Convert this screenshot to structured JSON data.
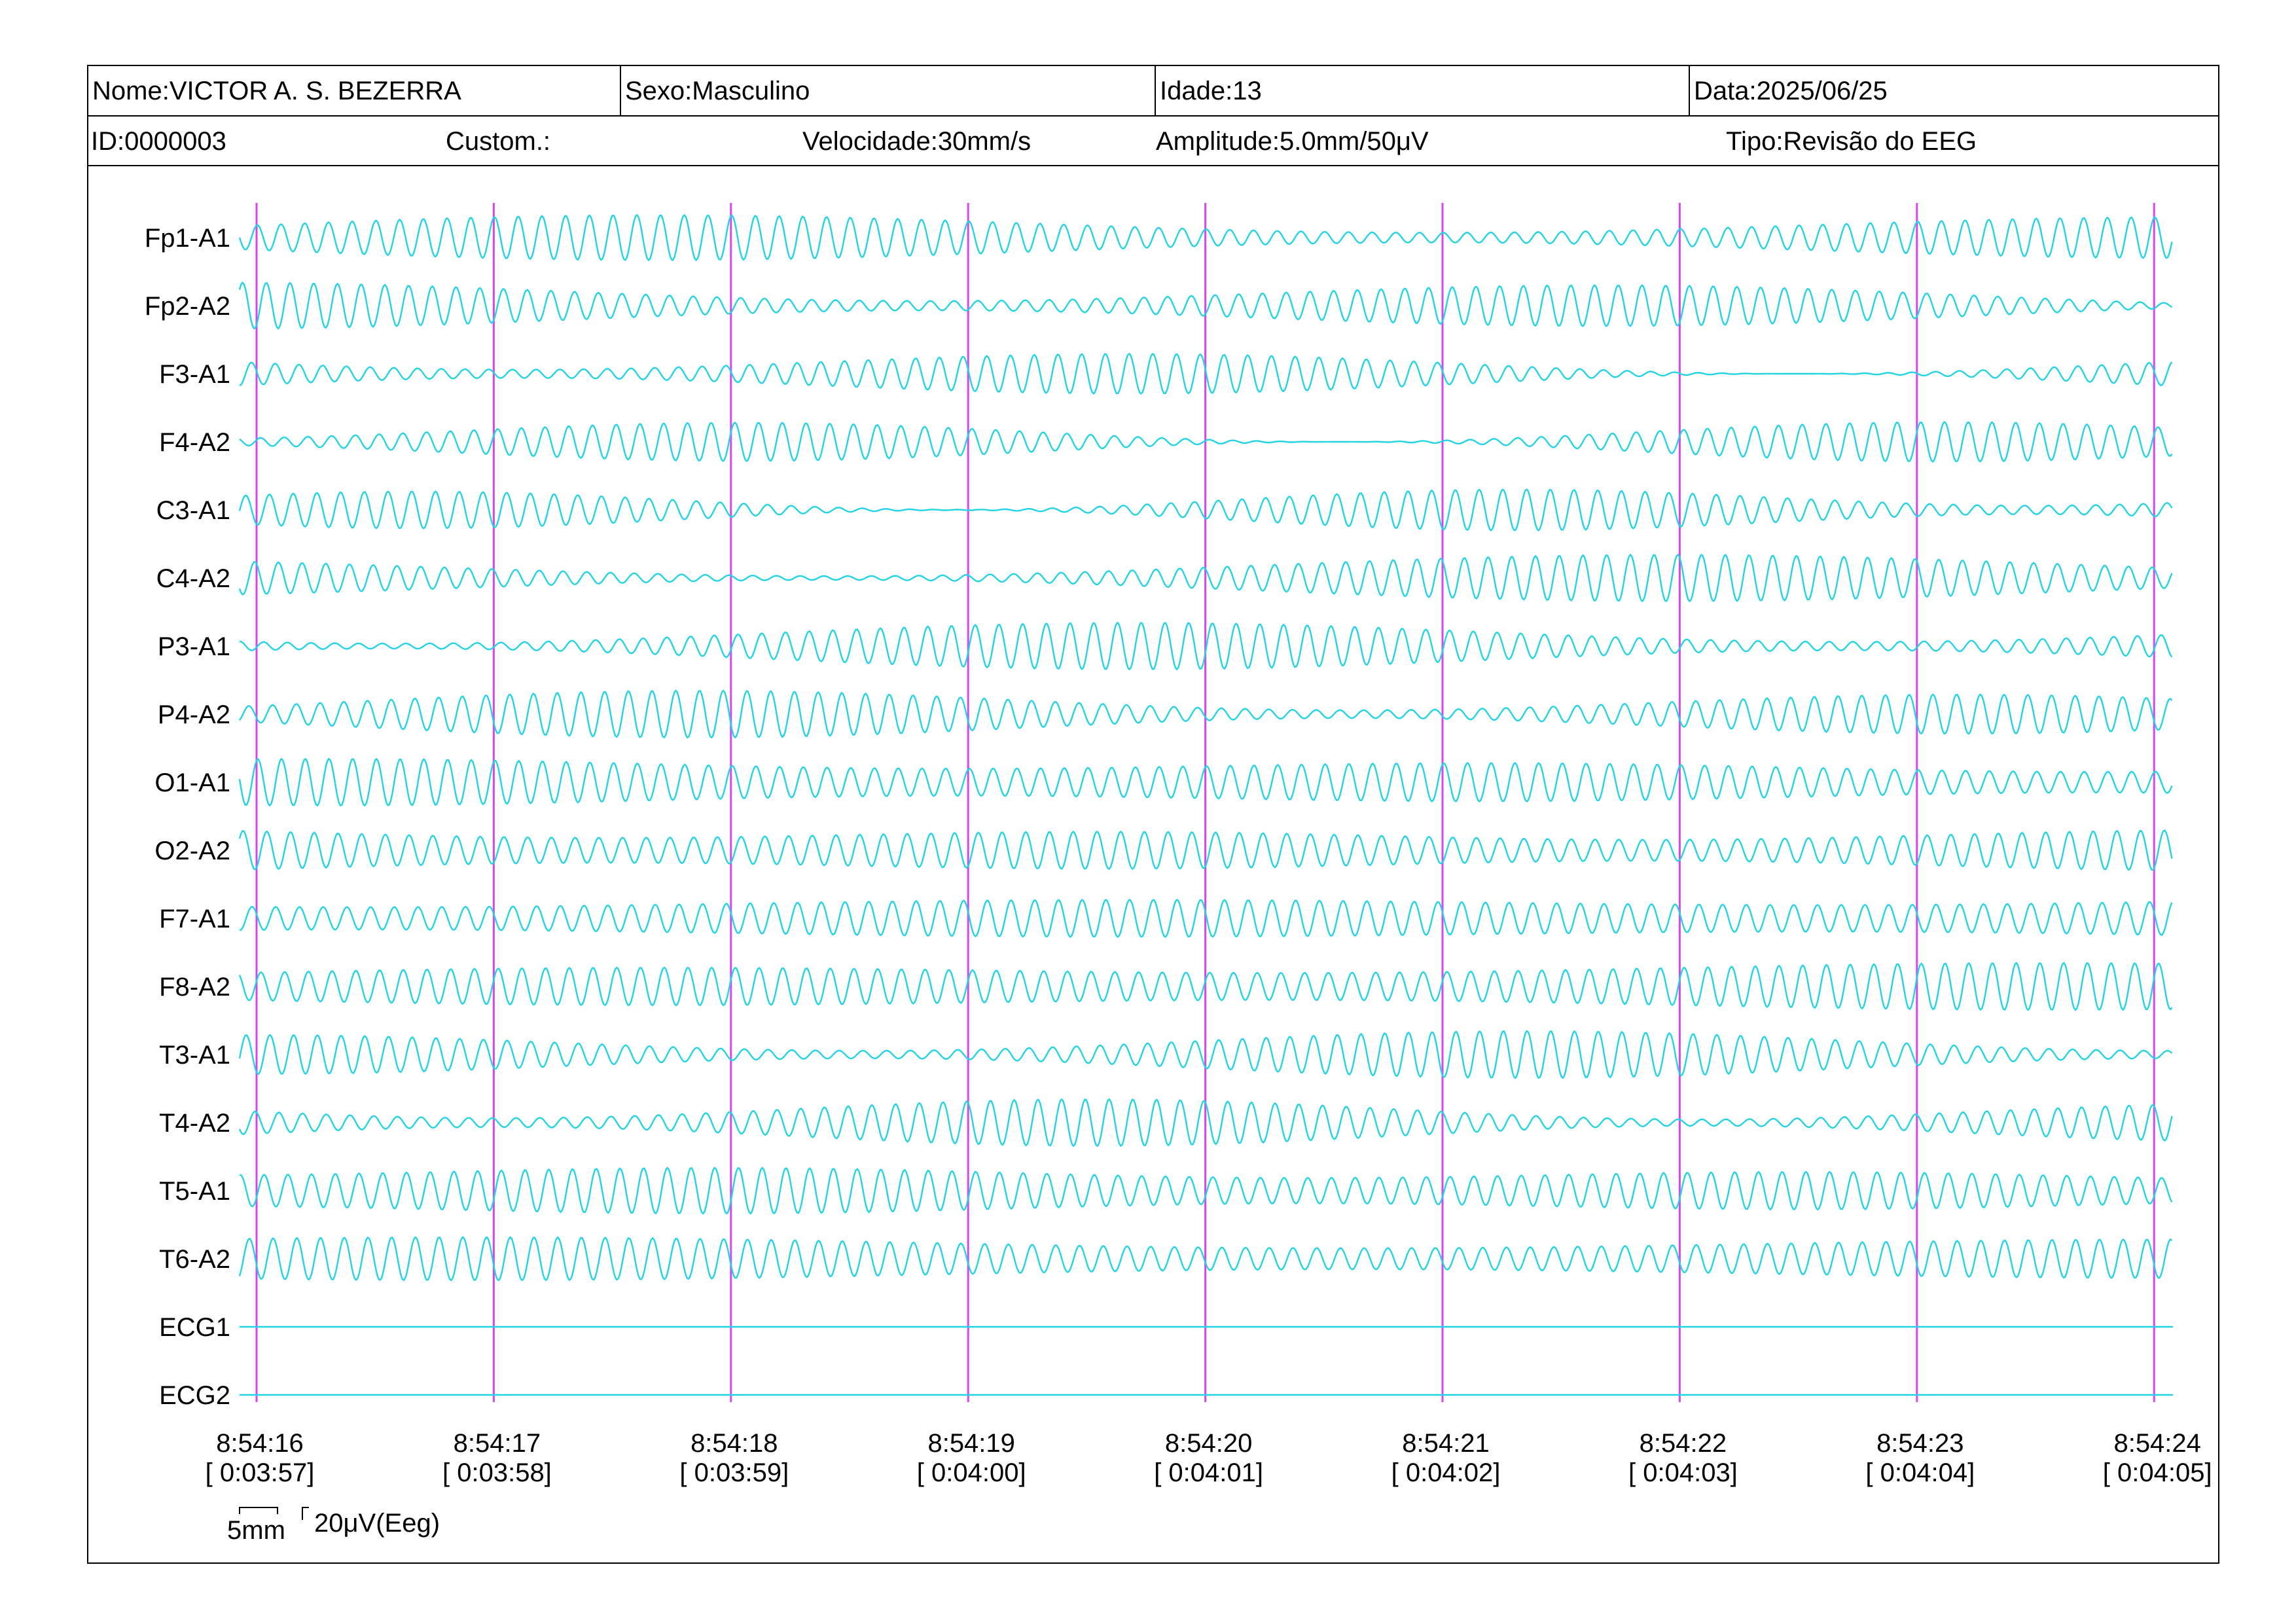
{
  "header": {
    "nome": "Nome:VICTOR A. S. BEZERRA",
    "sexo": "Sexo:Masculino",
    "idade": "Idade:13",
    "data": "Data:2025/06/25",
    "id": "ID:0000003",
    "custom": "Custom.:",
    "velocidade": "Velocidade:30mm/s",
    "amplitude": "Amplitude:5.0mm/50μV",
    "tipo": "Tipo:Revisão do EEG"
  },
  "colors": {
    "trace": "#22d3e6",
    "marker": "#d946ef",
    "border": "#000000"
  },
  "scale": {
    "time_label": "5mm",
    "amp_label": "20μV(Eeg)"
  },
  "chart_data": {
    "type": "line",
    "title": "",
    "xlabel": "",
    "ylabel": "",
    "channels": [
      "Fp1-A1",
      "Fp2-A2",
      "F3-A1",
      "F4-A2",
      "C3-A1",
      "C4-A2",
      "P3-A1",
      "P4-A2",
      "O1-A1",
      "O2-A2",
      "F7-A1",
      "F8-A2",
      "T3-A1",
      "T4-A2",
      "T5-A1",
      "T6-A2",
      "ECG1",
      "ECG2"
    ],
    "flat_channels": [
      "ECG1",
      "ECG2"
    ],
    "x_ticks": [
      {
        "clock": "8:54:16",
        "elapsed": "[ 0:03:57]"
      },
      {
        "clock": "8:54:17",
        "elapsed": "[ 0:03:58]"
      },
      {
        "clock": "8:54:18",
        "elapsed": "[ 0:03:59]"
      },
      {
        "clock": "8:54:19",
        "elapsed": "[ 0:04:00]"
      },
      {
        "clock": "8:54:20",
        "elapsed": "[ 0:04:01]"
      },
      {
        "clock": "8:54:21",
        "elapsed": "[ 0:04:02]"
      },
      {
        "clock": "8:54:22",
        "elapsed": "[ 0:04:03]"
      },
      {
        "clock": "8:54:23",
        "elapsed": "[ 0:04:04]"
      },
      {
        "clock": "8:54:24",
        "elapsed": "[ 0:04:05]"
      }
    ],
    "x_start": "8:54:16",
    "x_end": "8:54:24",
    "dominant_frequency_hz": 10,
    "grid": "vertical second markers"
  }
}
